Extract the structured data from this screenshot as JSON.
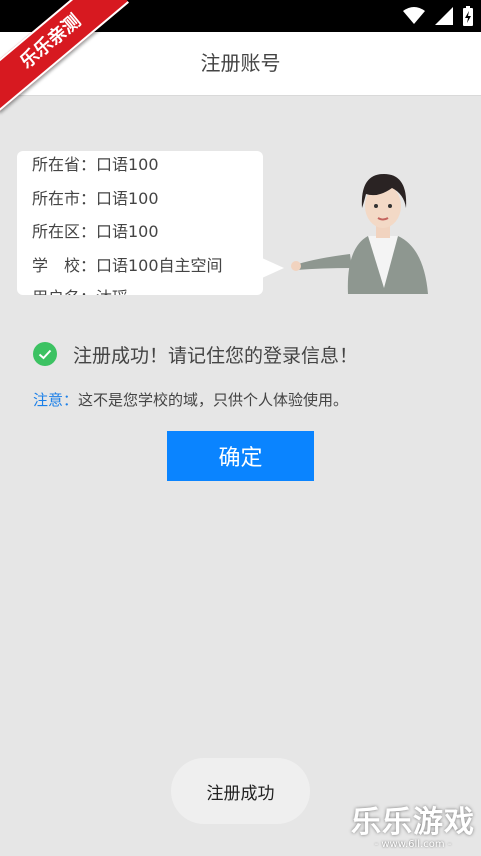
{
  "ribbon": {
    "text": "乐乐亲测"
  },
  "nav": {
    "title": "注册账号",
    "back_icon": "chevron-left-icon"
  },
  "info": {
    "lines": [
      "所在省：口语100",
      "所在市：口语100",
      "所在区：口语100",
      "学　校：口语100自主空间",
      "用户名：沐瑶"
    ]
  },
  "success": {
    "icon": "check-circle-icon",
    "text": "注册成功！请记住您的登录信息！"
  },
  "notice": {
    "label": "注意：",
    "text": "这不是您学校的域，只供个人体验使用。"
  },
  "confirm_button": {
    "label": "确定"
  },
  "toast": {
    "text": "注册成功"
  },
  "watermark": {
    "main": "乐乐游戏",
    "sub": "- www.6ll.com -"
  },
  "colors": {
    "accent": "#0a84ff",
    "success": "#3cc262",
    "notice_label": "#1a7fe8",
    "ribbon": "#d71920"
  }
}
